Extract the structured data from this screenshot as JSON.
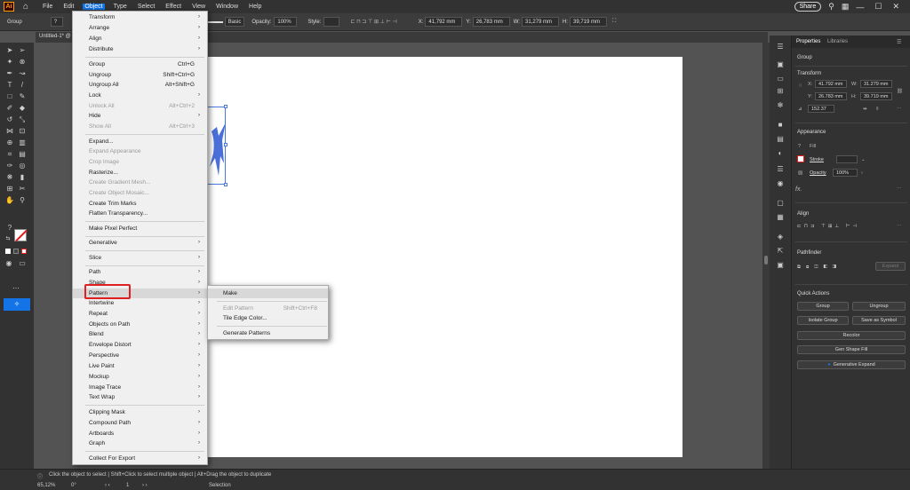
{
  "menubar": {
    "logo": "Ai",
    "items": [
      "File",
      "Edit",
      "Object",
      "Type",
      "Select",
      "Effect",
      "View",
      "Window",
      "Help"
    ],
    "share_label": "Share"
  },
  "controlbar": {
    "selection_label": "Group",
    "stroke_style": "Basic",
    "opacity_label": "Opacity:",
    "opacity_value": "100%",
    "style_label": "Style:",
    "x_label": "X:",
    "x_value": "41,792 mm",
    "y_label": "Y:",
    "y_value": "26,783 mm",
    "w_label": "W:",
    "w_value": "31,279 mm",
    "h_label": "H:",
    "h_value": "39,719 mm"
  },
  "document_tab": "Untitled-1* @",
  "object_menu": {
    "items": [
      {
        "label": "Transform",
        "submenu": true
      },
      {
        "label": "Arrange",
        "submenu": true
      },
      {
        "label": "Align",
        "submenu": true
      },
      {
        "label": "Distribute",
        "submenu": true
      },
      {
        "label": "Group",
        "shortcut": "Ctrl+G"
      },
      {
        "label": "Ungroup",
        "shortcut": "Shift+Ctrl+G"
      },
      {
        "label": "Ungroup All",
        "shortcut": "Alt+Shift+G"
      },
      {
        "label": "Lock",
        "submenu": true
      },
      {
        "label": "Unlock All",
        "shortcut": "Alt+Ctrl+2",
        "disabled": true
      },
      {
        "label": "Hide",
        "submenu": true
      },
      {
        "label": "Show All",
        "shortcut": "Alt+Ctrl+3",
        "disabled": true
      },
      {
        "label": "Expand..."
      },
      {
        "label": "Expand Appearance",
        "disabled": true
      },
      {
        "label": "Crop Image",
        "disabled": true
      },
      {
        "label": "Rasterize..."
      },
      {
        "label": "Create Gradient Mesh...",
        "disabled": true
      },
      {
        "label": "Create Object Mosaic...",
        "disabled": true
      },
      {
        "label": "Create Trim Marks"
      },
      {
        "label": "Flatten Transparency..."
      },
      {
        "label": "Make Pixel Perfect"
      },
      {
        "label": "Generative",
        "submenu": true
      },
      {
        "label": "Slice",
        "submenu": true
      },
      {
        "label": "Path",
        "submenu": true
      },
      {
        "label": "Shape",
        "submenu": true
      },
      {
        "label": "Pattern",
        "submenu": true
      },
      {
        "label": "Intertwine",
        "submenu": true
      },
      {
        "label": "Repeat",
        "submenu": true
      },
      {
        "label": "Objects on Path",
        "submenu": true
      },
      {
        "label": "Blend",
        "submenu": true
      },
      {
        "label": "Envelope Distort",
        "submenu": true
      },
      {
        "label": "Perspective",
        "submenu": true
      },
      {
        "label": "Live Paint",
        "submenu": true
      },
      {
        "label": "Mockup",
        "submenu": true
      },
      {
        "label": "Image Trace",
        "submenu": true
      },
      {
        "label": "Text Wrap",
        "submenu": true
      },
      {
        "label": "Clipping Mask",
        "submenu": true
      },
      {
        "label": "Compound Path",
        "submenu": true
      },
      {
        "label": "Artboards",
        "submenu": true
      },
      {
        "label": "Graph",
        "submenu": true
      },
      {
        "label": "Collect For Export",
        "submenu": true
      }
    ]
  },
  "pattern_submenu": {
    "items": [
      {
        "label": "Make"
      },
      {
        "label": "Edit Pattern",
        "shortcut": "Shift+Ctrl+F8",
        "disabled": true
      },
      {
        "label": "Tile Edge Color..."
      },
      {
        "label": "Generate Patterns"
      }
    ]
  },
  "properties": {
    "tabs": [
      "Properties",
      "Libraries"
    ],
    "group_label": "Group",
    "transform_label": "Transform",
    "x_label": "X:",
    "x_value": "41.792 mm",
    "y_label": "Y:",
    "y_value": "26.783 mm",
    "w_label": "W:",
    "w_value": "31.279 mm",
    "h_label": "H:",
    "h_value": "39.719 mm",
    "angle_value": "152.37",
    "appearance_label": "Appearance",
    "fill_label": "Fill",
    "stroke_label": "Stroke",
    "opacity_label": "Opacity",
    "opacity_value": "100%",
    "fx_label": "fx.",
    "align_label": "Align",
    "pathfinder_label": "Pathfinder",
    "expand_label": "Expand",
    "quick_actions_label": "Quick Actions",
    "btn_group": "Group",
    "btn_ungroup": "Ungroup",
    "btn_isolate": "Isolate Group",
    "btn_symbol": "Save as Symbol",
    "btn_recolor": "Recolor",
    "btn_gen_shape": "Gen Shape Fill",
    "btn_gen_expand": "Generative Expand"
  },
  "statusbar": {
    "hint": "Click the object to select  |  Shift+Click to select multiple object  |  Alt+Drag the object to duplicate",
    "zoom": "65,12%",
    "angle": "0°",
    "artboard_num": "1",
    "tool_name": "Selection"
  },
  "colors": {
    "accent": "#1473e6",
    "highlight_box": "#e02020",
    "selection": "#4a7bd8"
  }
}
